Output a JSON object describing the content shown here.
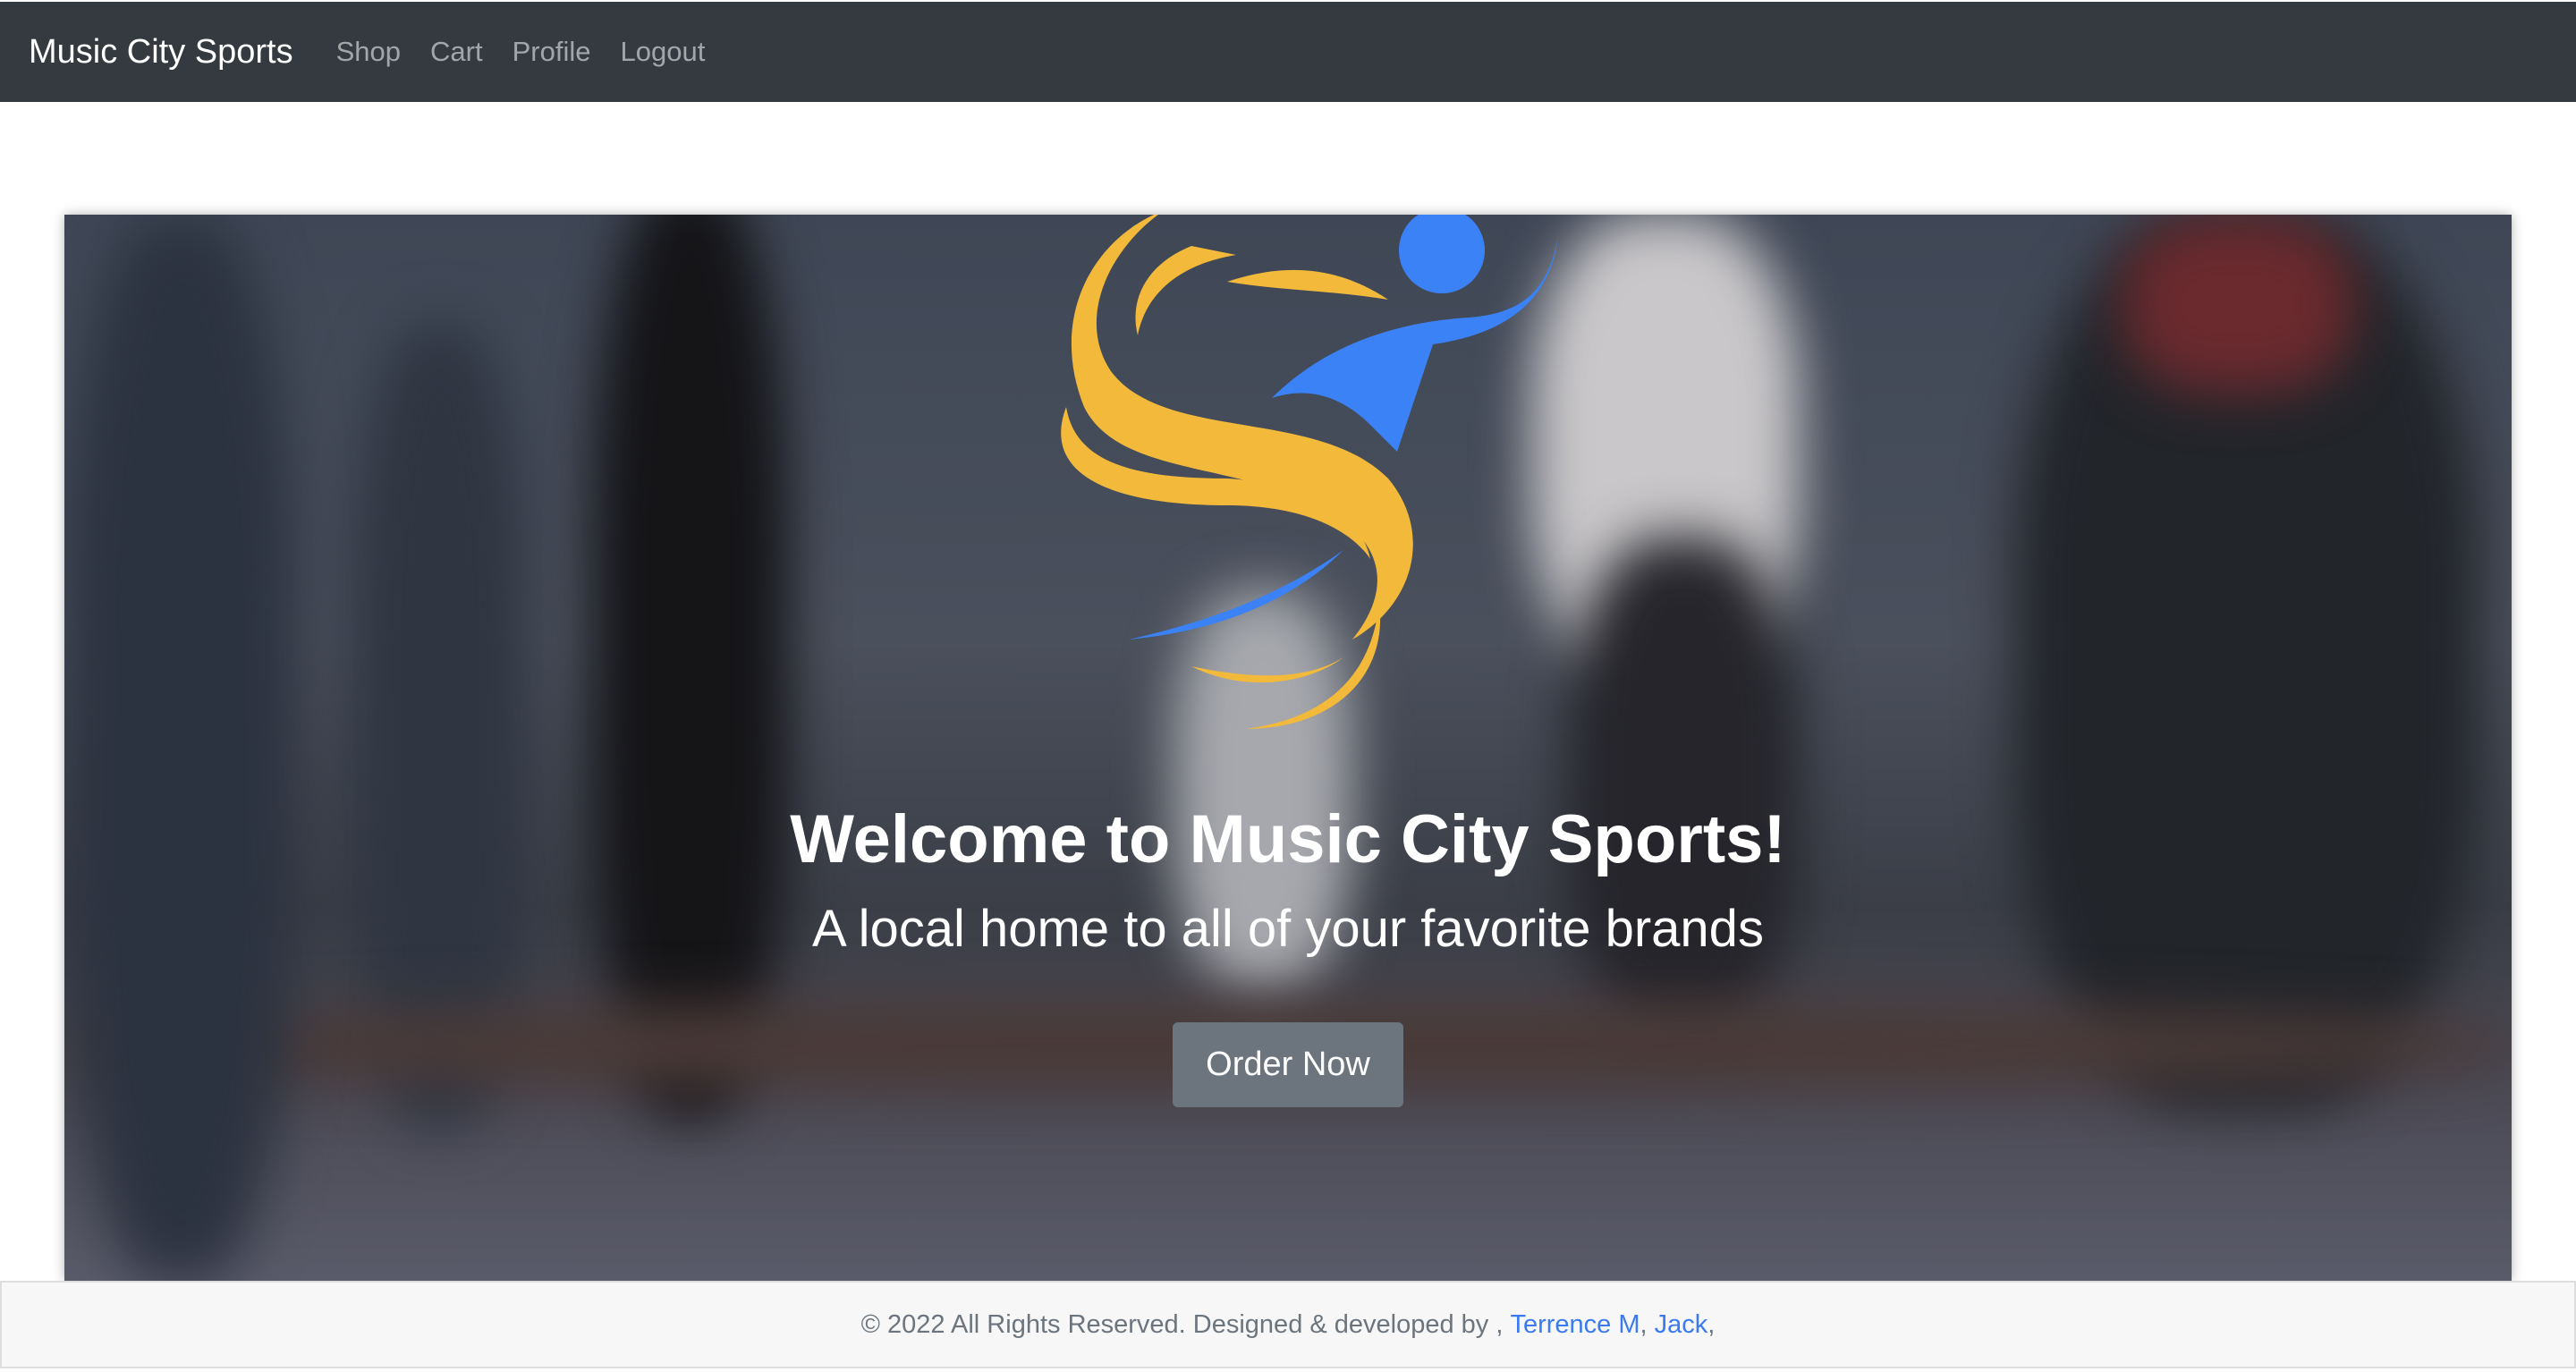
{
  "navbar": {
    "brand": "Music City Sports",
    "links": [
      "Shop",
      "Cart",
      "Profile",
      "Logout"
    ]
  },
  "hero": {
    "title": "Welcome to Music City Sports!",
    "subtitle": "A local home to all of your favorite brands",
    "button": "Order Now"
  },
  "footer": {
    "text": "© 2022 All Rights Reserved. Designed & developed by ,",
    "authors": [
      "Terrence M",
      "Jack"
    ],
    "sep": ",",
    "trail": ","
  },
  "colors": {
    "navbar": "#343a40",
    "logo_yellow": "#f2b93b",
    "logo_blue": "#3b82f6",
    "link": "#3b7bf0"
  }
}
